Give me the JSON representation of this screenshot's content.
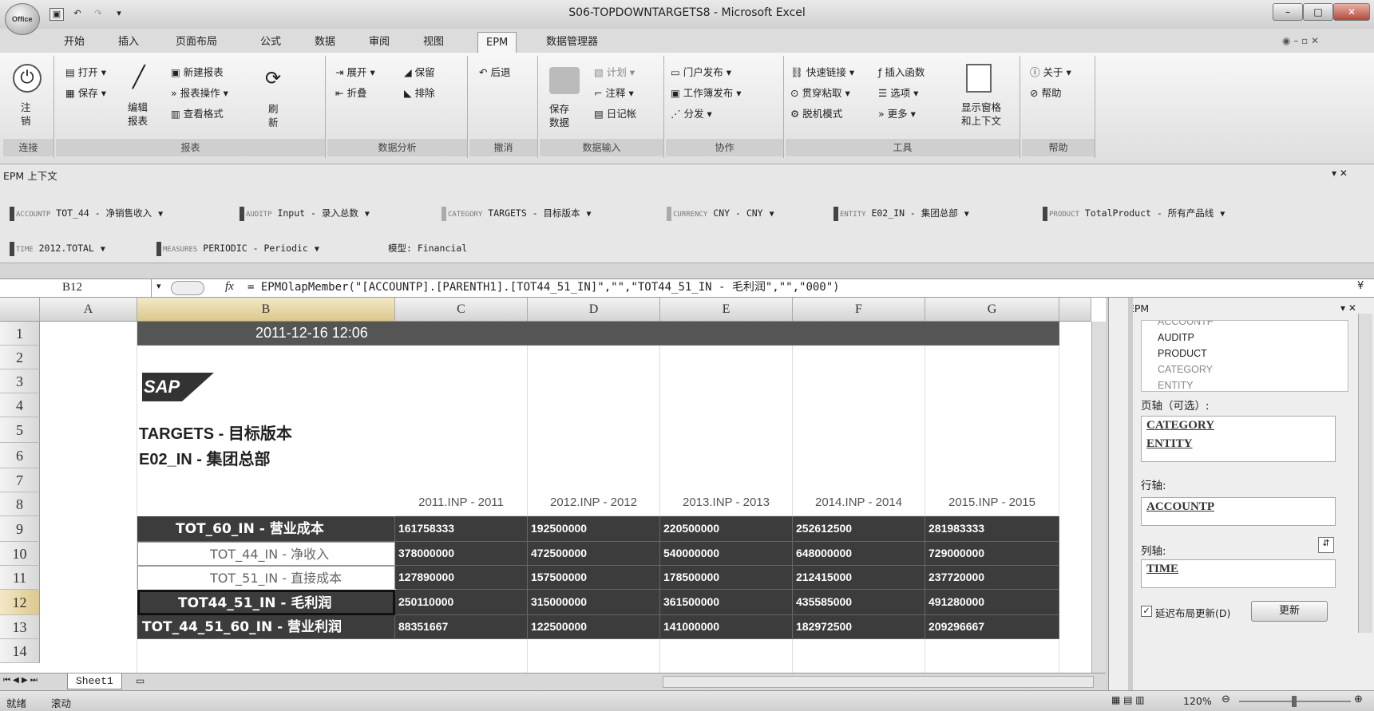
{
  "window": {
    "title": "S06-TOPDOWNTARGETS8 - Microsoft Excel",
    "office_logo": "Office"
  },
  "tabs": [
    "开始",
    "插入",
    "页面布局",
    "公式",
    "数据",
    "审阅",
    "视图",
    "EPM",
    "数据管理器"
  ],
  "ribbon": {
    "connect": {
      "label": "连接",
      "logoff": "注\n销"
    },
    "report": {
      "label": "报表",
      "open": "打开",
      "save": "保存",
      "edit": "编辑\n报表",
      "new_report": "新建报表",
      "report_actions": "报表操作",
      "view_format": "查看格式",
      "refresh": "刷\n新"
    },
    "analysis": {
      "label": "数据分析",
      "expand": "展开",
      "collapse": "折叠",
      "keep": "保留",
      "exclude": "排除"
    },
    "undo": {
      "label": "撤消",
      "back": "后退"
    },
    "input": {
      "label": "数据输入",
      "save_data": "保存\n数据",
      "plan": "计划",
      "comment": "注释",
      "journal": "日记帐"
    },
    "collab": {
      "label": "协作",
      "portal_publish": "门户发布",
      "workbook_publish": "工作簿发布",
      "distribute": "分发"
    },
    "tools": {
      "label": "工具",
      "quick_link": "快速链接",
      "insert_function": "插入函数",
      "drill_paste": "贯穿粘取",
      "options": "选项",
      "offline": "脱机模式",
      "more": "更多",
      "show_pane": "显示窗格\n和上下文"
    },
    "help": {
      "label": "帮助",
      "about": "关于",
      "help": "帮助"
    }
  },
  "context": {
    "title": "EPM 上下文",
    "dims": [
      {
        "prefix": "ACCOUNTP",
        "value": "TOT_44 - 净销售收入"
      },
      {
        "prefix": "AUDITP",
        "value": "Input - 录入总数"
      },
      {
        "prefix": "CATEGORY",
        "value": "TARGETS - 目标版本"
      },
      {
        "prefix": "CURRENCY",
        "value": "CNY - CNY"
      },
      {
        "prefix": "ENTITY",
        "value": "E02_IN - 集团总部"
      },
      {
        "prefix": "PRODUCT",
        "value": "TotalProduct - 所有产品线"
      },
      {
        "prefix": "TIME",
        "value": "2012.TOTAL"
      },
      {
        "prefix": "MEASURES",
        "value": "PERIODIC - Periodic"
      }
    ],
    "model": "模型: Financial"
  },
  "formula_bar": {
    "cell": "B12",
    "fx": "fx",
    "formula": "= EPMOlapMember(\"[ACCOUNTP].[PARENTH1].[TOT44_51_IN]\",\"\",\"TOT44_51_IN - 毛利润\",\"\",\"000\")"
  },
  "sheet": {
    "columns": [
      "A",
      "B",
      "C",
      "D",
      "E",
      "F",
      "G"
    ],
    "rows": [
      "1",
      "2",
      "3",
      "4",
      "5",
      "6",
      "7",
      "8",
      "9",
      "10",
      "11",
      "12",
      "13",
      "14"
    ],
    "timestamp": "2011-12-16 12:06",
    "logo": "SAP",
    "category_title": "TARGETS - 目标版本",
    "entity_title": "E02_IN - 集团总部",
    "col_headers": [
      "2011.INP - 2011",
      "2012.INP - 2012",
      "2013.INP - 2013",
      "2014.INP - 2014",
      "2015.INP - 2015"
    ],
    "data": [
      {
        "label": "TOT_60_IN - 营业成本",
        "values": [
          "161758333",
          "192500000",
          "220500000",
          "252612500",
          "281983333"
        ]
      },
      {
        "label": "TOT_44_IN - 净收入",
        "values": [
          "378000000",
          "472500000",
          "540000000",
          "648000000",
          "729000000"
        ]
      },
      {
        "label": "TOT_51_IN - 直接成本",
        "values": [
          "127890000",
          "157500000",
          "178500000",
          "212415000",
          "237720000"
        ]
      },
      {
        "label": "TOT44_51_IN - 毛利润",
        "values": [
          "250110000",
          "315000000",
          "361500000",
          "435585000",
          "491280000"
        ]
      },
      {
        "label": "TOT_44_51_60_IN - 营业利润",
        "values": [
          "88351667",
          "122500000",
          "141000000",
          "182972500",
          "209296667"
        ]
      }
    ],
    "sheet_tab": "Sheet1"
  },
  "pane": {
    "title": "EPM",
    "tree": [
      "ACCOUNTP",
      "AUDITP",
      "PRODUCT",
      "CATEGORY",
      "ENTITY"
    ],
    "page_axis_label": "页轴（可选）:",
    "page_axis": [
      "CATEGORY",
      "ENTITY"
    ],
    "row_axis_label": "行轴:",
    "row_axis": [
      "ACCOUNTP"
    ],
    "col_axis_label": "列轴:",
    "col_axis": [
      "TIME"
    ],
    "defer_label": "延迟布局更新(D)",
    "update_button": "更新"
  },
  "status": {
    "ready": "就绪",
    "scroll": "滚动",
    "zoom": "120%"
  }
}
